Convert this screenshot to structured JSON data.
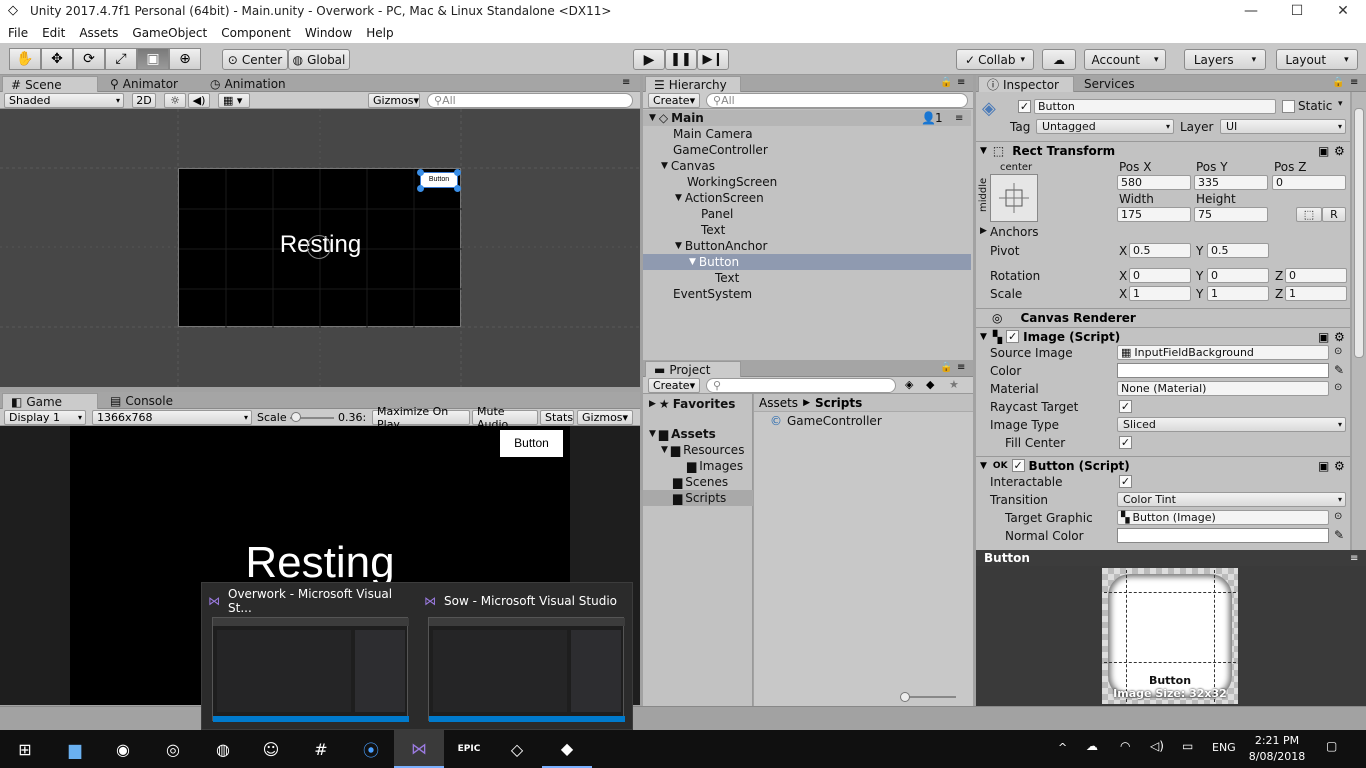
{
  "window": {
    "title": "Unity 2017.4.7f1 Personal (64bit) - Main.unity - Overwork - PC, Mac & Linux Standalone <DX11>"
  },
  "menu": [
    "File",
    "Edit",
    "Assets",
    "GameObject",
    "Component",
    "Window",
    "Help"
  ],
  "toolbar": {
    "center": "Center",
    "global": "Global",
    "collab": "Collab",
    "account": "Account",
    "layers": "Layers",
    "layout": "Layout"
  },
  "scene": {
    "tabs": [
      "Scene",
      "Animator",
      "Animation"
    ],
    "shading": "Shaded",
    "mode2d": "2D",
    "gizmos": "Gizmos",
    "search_placeholder": "All",
    "button_label": "Button",
    "text": "Resting"
  },
  "game": {
    "tabs": [
      "Game",
      "Console"
    ],
    "display": "Display 1",
    "resolution": "1366x768",
    "scale_label": "Scale",
    "scale_value": "0.36:",
    "maximize": "Maximize On Play",
    "mute": "Mute Audio",
    "stats": "Stats",
    "gizmos": "Gizmos",
    "button_label": "Button",
    "text": "Resting"
  },
  "hierarchy": {
    "tab": "Hierarchy",
    "create": "Create",
    "search_placeholder": "All",
    "scene_name": "Main",
    "user_count": "1",
    "items": [
      "Main Camera",
      "GameController",
      "Canvas",
      "WorkingScreen",
      "ActionScreen",
      "Panel",
      "Text",
      "ButtonAnchor",
      "Button",
      "Text",
      "EventSystem"
    ]
  },
  "project": {
    "tab": "Project",
    "create": "Create",
    "favorites": "Favorites",
    "assets": "Assets",
    "folders": [
      "Resources",
      "Images",
      "Scenes",
      "Scripts"
    ],
    "breadcrumb": [
      "Assets",
      "Scripts"
    ],
    "file": "GameController"
  },
  "inspector": {
    "tabs": [
      "Inspector",
      "Services"
    ],
    "object_name": "Button",
    "static": "Static",
    "tag_label": "Tag",
    "tag_value": "Untagged",
    "layer_label": "Layer",
    "layer_value": "UI",
    "rect": {
      "title": "Rect Transform",
      "anchor_h": "center",
      "anchor_v": "middle",
      "posx_label": "Pos X",
      "posy_label": "Pos Y",
      "posz_label": "Pos Z",
      "posx": "580",
      "posy": "335",
      "posz": "0",
      "width_label": "Width",
      "height_label": "Height",
      "width": "175",
      "height": "75",
      "anchors": "Anchors",
      "pivot": "Pivot",
      "pivot_x": "0.5",
      "pivot_y": "0.5",
      "rotation": "Rotation",
      "rot_x": "0",
      "rot_y": "0",
      "rot_z": "0",
      "scale": "Scale",
      "scale_x": "1",
      "scale_y": "1",
      "scale_z": "1",
      "r_btn": "R"
    },
    "canvas_renderer": "Canvas Renderer",
    "image": {
      "title": "Image (Script)",
      "source_label": "Source Image",
      "source_value": "InputFieldBackground",
      "color_label": "Color",
      "material_label": "Material",
      "material_value": "None (Material)",
      "raycast_label": "Raycast Target",
      "type_label": "Image Type",
      "type_value": "Sliced",
      "fill_label": "Fill Center"
    },
    "button": {
      "title": "Button (Script)",
      "interactable_label": "Interactable",
      "transition_label": "Transition",
      "transition_value": "Color Tint",
      "target_label": "Target Graphic",
      "target_value": "Button (Image)",
      "normal_label": "Normal Color"
    },
    "preview_title": "Button",
    "preview_name": "Button",
    "preview_size": "Image Size: 32x32"
  },
  "xyz": {
    "x": "X",
    "y": "Y",
    "z": "Z"
  },
  "taskbar": {
    "thumb1": "Overwork - Microsoft Visual St...",
    "thumb2": "Sow - Microsoft Visual Studio",
    "lang": "ENG",
    "time": "2:21 PM",
    "date": "8/08/2018"
  }
}
